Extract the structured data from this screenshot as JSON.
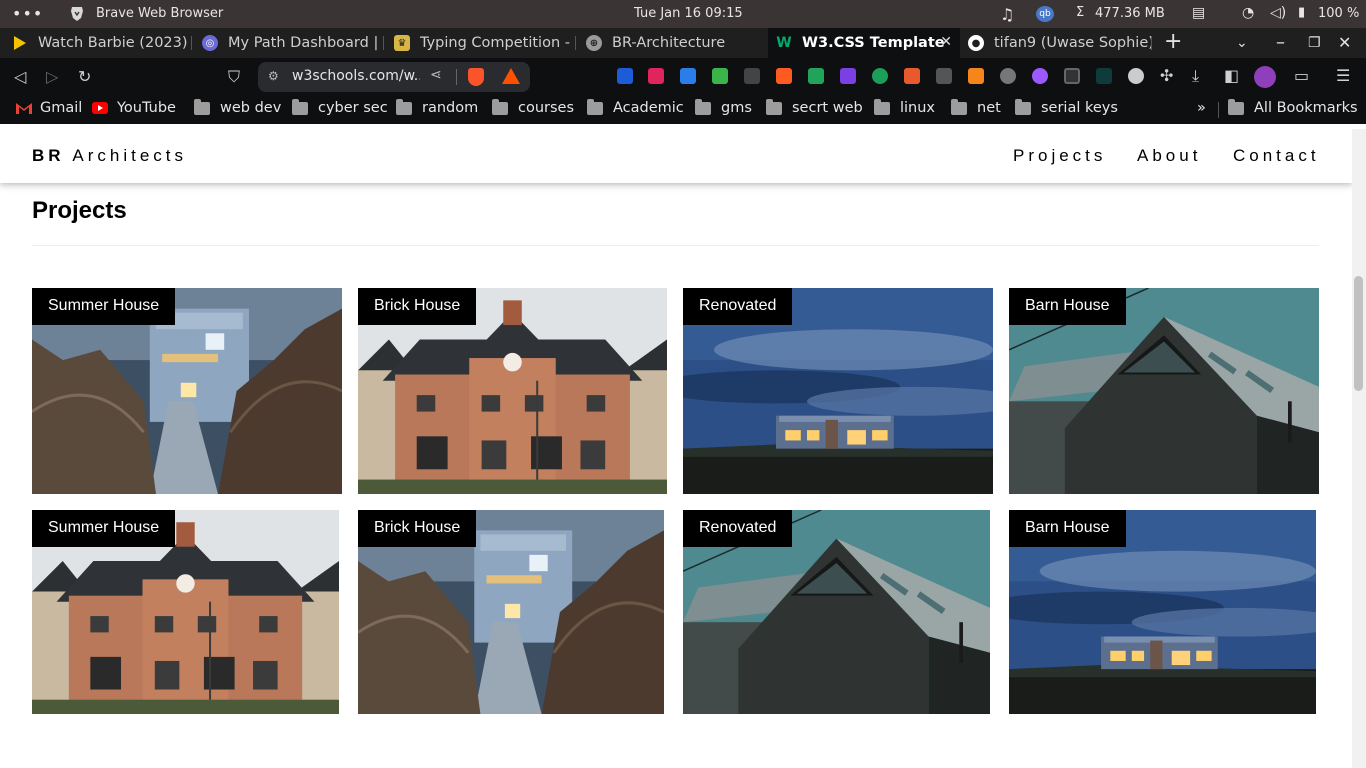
{
  "os": {
    "app_name": "Brave Web Browser",
    "clock": "Tue Jan 16  09:15",
    "memory": "477.36 MB",
    "battery": "100 %"
  },
  "tabs": [
    {
      "label": "Watch Barbie (2023) fu",
      "icon": "play-icon",
      "color": "#f5c400"
    },
    {
      "label": "My Path Dashboard | W",
      "icon": "dashboard-icon",
      "color": "#6b6bd6"
    },
    {
      "label": "Typing Competition - 1",
      "icon": "trophy-icon",
      "color": "#d9b545"
    },
    {
      "label": "BR-Architecture",
      "icon": "globe-icon",
      "color": "#9a9a9a"
    },
    {
      "label": "W3.CSS Template",
      "icon": "w3-icon",
      "color": "#04aa6d",
      "active": true
    },
    {
      "label": "tifan9 (Uwase Sophie)",
      "icon": "github-icon",
      "color": "#ffffff"
    }
  ],
  "toolbar": {
    "url": "w3schools.com/w..."
  },
  "bookmarks": [
    {
      "label": "Gmail",
      "type": "gmail"
    },
    {
      "label": "YouTube",
      "type": "youtube"
    },
    {
      "label": "web dev",
      "type": "folder"
    },
    {
      "label": "cyber sec",
      "type": "folder"
    },
    {
      "label": "random",
      "type": "folder"
    },
    {
      "label": "courses",
      "type": "folder"
    },
    {
      "label": "Academic",
      "type": "folder"
    },
    {
      "label": "gms",
      "type": "folder"
    },
    {
      "label": "secrt web",
      "type": "folder"
    },
    {
      "label": "linux",
      "type": "folder"
    },
    {
      "label": "net",
      "type": "folder"
    },
    {
      "label": "serial keys",
      "type": "folder"
    }
  ],
  "bookmarks_overflow": "»",
  "all_bookmarks": "All Bookmarks",
  "site": {
    "brand_bold": "BR",
    "brand_rest": "Architects",
    "nav": [
      "Projects",
      "About",
      "Contact"
    ],
    "section_title": "Projects"
  },
  "projects": [
    {
      "label": "Summer House",
      "scene": "summer"
    },
    {
      "label": "Brick House",
      "scene": "brick"
    },
    {
      "label": "Renovated",
      "scene": "renovated"
    },
    {
      "label": "Barn House",
      "scene": "barn"
    },
    {
      "label": "Summer House",
      "scene": "brick"
    },
    {
      "label": "Brick House",
      "scene": "summer"
    },
    {
      "label": "Renovated",
      "scene": "barn"
    },
    {
      "label": "Barn House",
      "scene": "renovated"
    }
  ]
}
